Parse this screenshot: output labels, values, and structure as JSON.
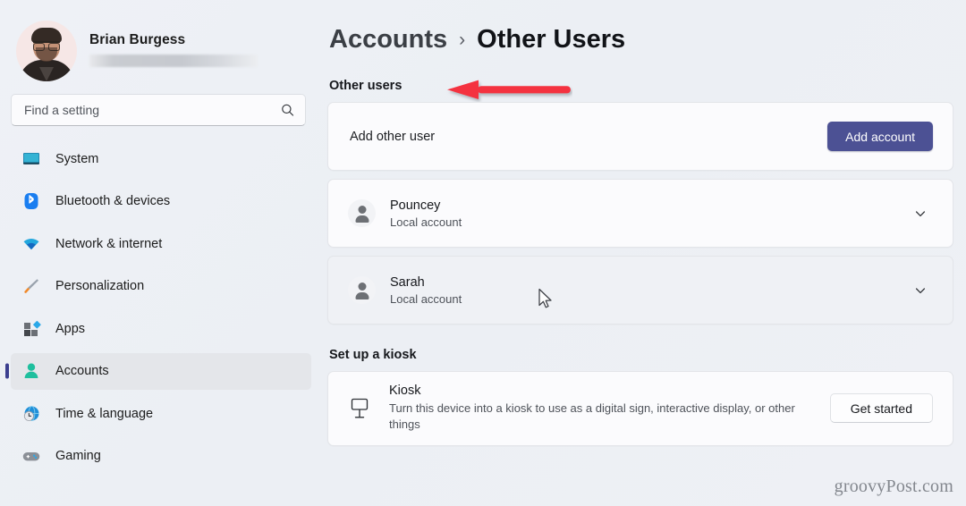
{
  "profile": {
    "name": "Brian Burgess",
    "email_redacted": true,
    "avatar_icon": "user-photo-avatar"
  },
  "search": {
    "placeholder": "Find a setting",
    "icon": "search-icon"
  },
  "sidebar": {
    "items": [
      {
        "label": "System",
        "icon": "monitor-icon",
        "selected": false
      },
      {
        "label": "Bluetooth & devices",
        "icon": "bluetooth-icon",
        "selected": false
      },
      {
        "label": "Network & internet",
        "icon": "wifi-icon",
        "selected": false
      },
      {
        "label": "Personalization",
        "icon": "paintbrush-icon",
        "selected": false
      },
      {
        "label": "Apps",
        "icon": "apps-blocks-icon",
        "selected": false
      },
      {
        "label": "Accounts",
        "icon": "person-icon",
        "selected": true
      },
      {
        "label": "Time & language",
        "icon": "clock-globe-icon",
        "selected": false
      },
      {
        "label": "Gaming",
        "icon": "gamepad-icon",
        "selected": false
      }
    ]
  },
  "header": {
    "breadcrumb_parent": "Accounts",
    "breadcrumb_separator": "›",
    "breadcrumb_current": "Other Users"
  },
  "main": {
    "other_users_section": {
      "label": "Other users",
      "add_user": {
        "label": "Add other user",
        "button_label": "Add account"
      },
      "accounts": [
        {
          "name": "Pouncey",
          "type": "Local account",
          "icon": "person-avatar-icon",
          "chevron": "chevron-down-icon",
          "hovered": false
        },
        {
          "name": "Sarah",
          "type": "Local account",
          "icon": "person-avatar-icon",
          "chevron": "chevron-down-icon",
          "hovered": true
        }
      ]
    },
    "kiosk_section": {
      "label": "Set up a kiosk",
      "title": "Kiosk",
      "description": "Turn this device into a kiosk to use as a digital sign, interactive display, or other things",
      "button_label": "Get started",
      "icon": "kiosk-display-icon"
    }
  },
  "annotation": {
    "arrow_icon": "red-left-arrow",
    "arrow_color": "#f4333f"
  },
  "watermark": {
    "text": "groovyPost.com"
  },
  "colors": {
    "accent_button": "#4c5194",
    "selection_bar": "#3c3f8f",
    "page_background": "#eef1f5",
    "card_background": "#fbfbfd",
    "annotation_red": "#f4333f"
  }
}
